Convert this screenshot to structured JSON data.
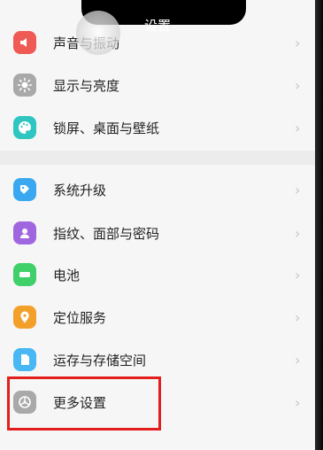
{
  "header": {
    "title": "设置"
  },
  "menu": {
    "group1": [
      {
        "label": "声音与振动",
        "icon": "sound-icon",
        "color": "#f05a55"
      },
      {
        "label": "显示与亮度",
        "icon": "brightness-icon",
        "color": "#a9a9a9"
      },
      {
        "label": "锁屏、桌面与壁纸",
        "icon": "theme-palette-icon",
        "color": "#2fc6c1"
      }
    ],
    "group2": [
      {
        "label": "系统升级",
        "icon": "system-update-icon",
        "color": "#3aa8f0"
      },
      {
        "label": "指纹、面部与密码",
        "icon": "fingerprint-icon",
        "color": "#a066e0"
      },
      {
        "label": "电池",
        "icon": "battery-icon",
        "color": "#3fd06a"
      },
      {
        "label": "定位服务",
        "icon": "location-pin-icon",
        "color": "#f3a02a"
      },
      {
        "label": "运存与存储空间",
        "icon": "storage-icon",
        "color": "#48b7f3"
      },
      {
        "label": "更多设置",
        "icon": "more-settings-icon",
        "color": "#a9a9a9"
      }
    ]
  },
  "chevron": "›"
}
